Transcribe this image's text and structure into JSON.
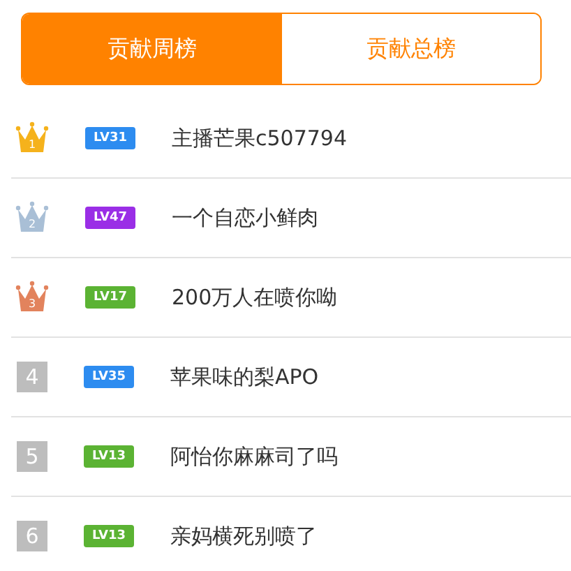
{
  "tabs": [
    {
      "label": "贡献周榜",
      "selected": true
    },
    {
      "label": "贡献总榜",
      "selected": false
    }
  ],
  "rows": [
    {
      "kind": "crown",
      "rank": "1",
      "color": "#f5b21c",
      "badge": {
        "label": "LV31",
        "color": "#2d8cf0"
      },
      "name": "主播芒果c507794"
    },
    {
      "kind": "crown",
      "rank": "2",
      "color": "#a9bfd6",
      "badge": {
        "label": "LV47",
        "color": "#9a2ee6"
      },
      "name": "一个自恋小鲜肉"
    },
    {
      "kind": "crown",
      "rank": "3",
      "color": "#e2835d",
      "badge": {
        "label": "LV17",
        "color": "#5bb333"
      },
      "name": "200万人在喷你呦"
    },
    {
      "kind": "number",
      "rank": "4",
      "badge": {
        "label": "LV35",
        "color": "#2d8cf0"
      },
      "name": "苹果味的梨APO"
    },
    {
      "kind": "number",
      "rank": "5",
      "badge": {
        "label": "LV13",
        "color": "#5bb333"
      },
      "name": "阿怡你麻麻司了吗"
    },
    {
      "kind": "number",
      "rank": "6",
      "badge": {
        "label": "LV13",
        "color": "#5bb333"
      },
      "name": "亲妈横死别喷了"
    }
  ]
}
